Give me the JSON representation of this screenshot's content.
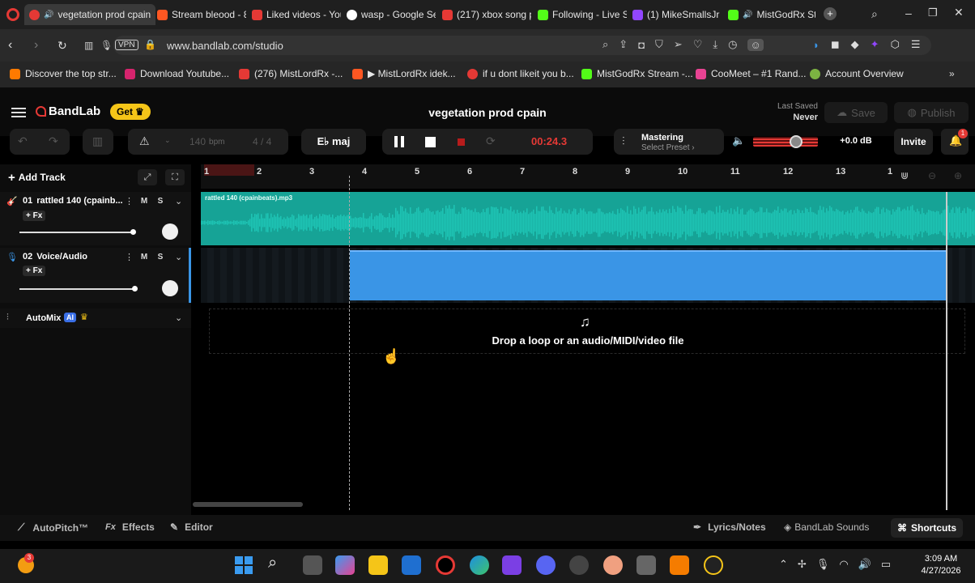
{
  "browser": {
    "tabs": [
      {
        "label": "vegetation prod cpain",
        "active": true,
        "color": "#e53935"
      },
      {
        "label": "Stream bleood - 8",
        "color": "#ff5722"
      },
      {
        "label": "Liked videos - You",
        "color": "#e53935"
      },
      {
        "label": "wasp - Google Se",
        "color": "#4285f4"
      },
      {
        "label": "(217) xbox song p",
        "color": "#e53935"
      },
      {
        "label": "Following - Live S",
        "color": "#53fc18"
      },
      {
        "label": "(1) MikeSmallsJr",
        "color": "#9146ff"
      },
      {
        "label": "MistGodRx Str",
        "color": "#53fc18"
      }
    ],
    "url": "www.bandlab.com/studio",
    "vpn_label": "VPN",
    "bookmarks": [
      "Discover the top str...",
      "Download Youtube...",
      "(276) MistLordRx -...",
      "▶ MistLordRx idek...",
      "if u dont likeit you b...",
      "MistGodRx Stream -...",
      "CooMeet – #1 Rand...",
      "Account Overview"
    ]
  },
  "app": {
    "logo": "BandLab",
    "get_label": "Get",
    "project_title": "vegetation prod cpain",
    "last_saved_label": "Last Saved",
    "last_saved_value": "Never",
    "save_label": "Save",
    "publish_label": "Publish",
    "bpm_value": "140",
    "bpm_unit": "bpm",
    "time_signature": "4 / 4",
    "key": "E♭ maj",
    "time_display": "00:24.3",
    "mastering_label": "Mastering",
    "mastering_preset": "Select Preset ›",
    "volume_db": "+0.0 dB",
    "invite_label": "Invite",
    "notification_count": "1",
    "add_track_label": "Add Track",
    "accent": "#e53935",
    "waveform_color": "#1ec5b5",
    "voice_region_color": "#3a95e6"
  },
  "tracks": [
    {
      "number": "01",
      "name": "rattled 140 (cpainb...",
      "fx": "+ Fx",
      "mute": "M",
      "solo": "S",
      "region_label": "rattled 140 (cpainbeats).mp3"
    },
    {
      "number": "02",
      "name": "Voice/Audio",
      "fx": "+ Fx",
      "mute": "M",
      "solo": "S"
    }
  ],
  "automix": {
    "label": "AutoMix",
    "ai_badge": "AI"
  },
  "ruler_numbers": [
    "1",
    "2",
    "3",
    "4",
    "5",
    "6",
    "7",
    "8",
    "9",
    "10",
    "11",
    "12",
    "13",
    "1"
  ],
  "drop_zone_text": "Drop a loop or an audio/MIDI/video file",
  "bottom_bar": {
    "autopitch": "AutoPitch™",
    "effects_prefix": "Fx",
    "effects": "Effects",
    "editor": "Editor",
    "lyrics": "Lyrics/Notes",
    "sounds": "BandLab Sounds",
    "shortcuts": "Shortcuts"
  },
  "taskbar": {
    "time": "3:09 AM",
    "date": "4/27/2026",
    "badge": "3"
  }
}
